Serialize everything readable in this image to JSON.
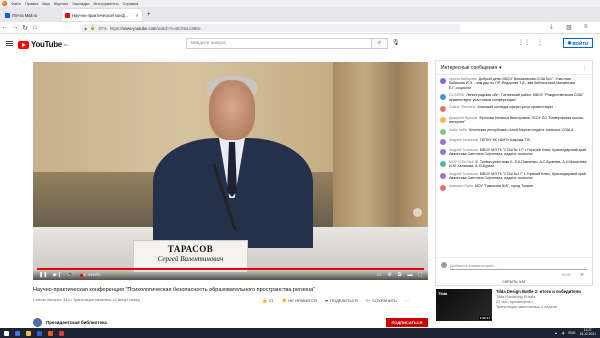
{
  "browser": {
    "menu": [
      "Файл",
      "Правка",
      "Вид",
      "Журнал",
      "Закладки",
      "Инструменты",
      "Справка"
    ],
    "tabs": [
      {
        "label": "Почта Mail.ru",
        "favicon_color": "#005ff9"
      },
      {
        "label": "Научно-практическая конф..."
      }
    ],
    "new_tab": "+",
    "url_prefix": "https://",
    "url_host": "www.youtube.com",
    "url_path": "/watch?v=BCMxLv3BtIc",
    "zoom": "67%"
  },
  "youtube": {
    "logo_word": "YouTube",
    "logo_region": "RU",
    "search_placeholder": "Введите запрос",
    "signin_label": "ВОЙТИ"
  },
  "video": {
    "name": "ТАРАСОВ",
    "subtitle": "Сергей Валентинович",
    "live_label": "В ЭФИРЕ",
    "title": "Научно-практическая конференция \"Психологическая безопасность образовательного пространства региона\"",
    "meta": "Сейчас смотрят: 343 • Трансляция началась 12 минут назад",
    "likes": "21",
    "dislike_label": "НЕ НРАВИТСЯ",
    "share_label": "ПОДЕЛИТЬСЯ",
    "save_label": "СОХРАНИТЬ"
  },
  "channel": {
    "name": "Президентская библиотека",
    "subscribe_label": "ПОДПИСАТЬСЯ"
  },
  "chat": {
    "header": "Интересные сообщения",
    "messages": [
      {
        "author": "Ирина Бабикова",
        "text": "Добрый день! МБОУ Волжковская СОШ №1\". Участник: Бабикова И.Э. , зам.дир по ПР, Федорова Т.И., зав библиотекой,Михайлова Е.Г.,социолог",
        "color": "#7b68ee"
      },
      {
        "author": "OLGERD",
        "text": "Ленинградская обл , Гатчинский район, МБОУ \"Рождественская СОШ\" приветствуют участников конференции!",
        "color": "#4a90d9"
      },
      {
        "author": "Galina Sheshina",
        "text": "Анапский колледж сферы услуг приветствует",
        "color": "#e57373"
      },
      {
        "author": "Дмитрий Фролов",
        "text": "Фролова Наталья Викторовна, ГБОУ ПО \"Кемеровская школа-интернат\"",
        "color": "#ffb74d"
      },
      {
        "author": "Аиба Аиба",
        "text": "Чеченская республика г.Аной Мартан педагог психолог СОШ 6",
        "color": "#81c784"
      },
      {
        "author": "Андрей Толкачев",
        "text": "ГБПОУ КК «АМТ» Шарова Т.В.",
        "color": "#9575cd"
      },
      {
        "author": "Андрей Толкачев",
        "text": "МБОУ МО ГК \"СОШ № 17\" г Горячий Ключ, Краснодарский край Авакесова Светлана Сергеевна, педагог-психолог",
        "color": "#9575cd"
      },
      {
        "author": "МОУ СОШ №4",
        "text": "Е. Тихвин,участники Б. Е.А.Павленко, А.С.Бунеева, А.Н.Масалева, И.Ю.Хализова, А.М.Бурзин",
        "color": "#4db6ac"
      },
      {
        "author": "Андрей Толкачев",
        "text": "МБОУ МО ГК \"СОШ №17\" г. Горячий Ключ, Краснодарский край Авакесова Светлана Сергеевна, педагог-психолог",
        "color": "#9575cd"
      },
      {
        "author": "Аманата Путм",
        "text": "МОУ \"Гимназия №5\", город Тихвин",
        "color": "#e57373"
      }
    ],
    "input_placeholder": "Добавить комментарий...",
    "char_count": "0/200",
    "hide_label": "СКРЫТЬ ЧАТ"
  },
  "recommendation": {
    "thumb_text": "Tilda",
    "duration": "1:22:17",
    "title": "Tilda Design Battle 2: итоги и победители",
    "channel": "Tilda Publishing Russia",
    "views": "22 тыс. просмотров •",
    "date": "Трансляция закончилась 2 недели"
  },
  "taskbar": {
    "lang": "ENG",
    "time": "11:27",
    "date": "15.12.2021"
  }
}
